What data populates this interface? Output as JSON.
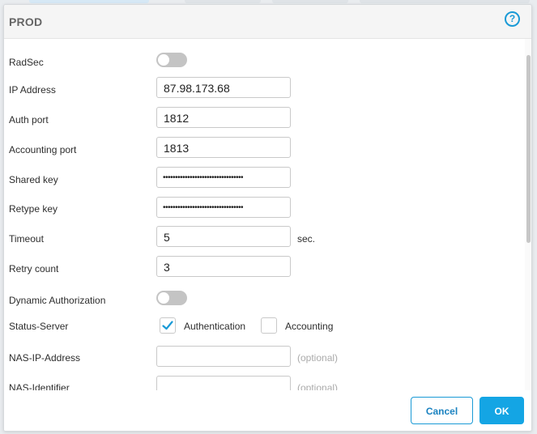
{
  "dialog": {
    "title": "PROD",
    "help_icon": "help-circle-icon"
  },
  "fields": {
    "radsec": {
      "label": "RadSec",
      "on": false
    },
    "ip_address": {
      "label": "IP Address",
      "value": "87.98.173.68"
    },
    "auth_port": {
      "label": "Auth port",
      "value": "1812"
    },
    "accounting_port": {
      "label": "Accounting port",
      "value": "1813"
    },
    "shared_key": {
      "label": "Shared key",
      "value": "•••••••••••••••••••••••••••••••••"
    },
    "retype_key": {
      "label": "Retype key",
      "value": "•••••••••••••••••••••••••••••••••"
    },
    "timeout": {
      "label": "Timeout",
      "value": "5",
      "suffix": "sec."
    },
    "retry_count": {
      "label": "Retry count",
      "value": "3"
    },
    "dynamic_authorization": {
      "label": "Dynamic Authorization",
      "on": false
    },
    "status_server": {
      "label": "Status-Server",
      "authentication": {
        "label": "Authentication",
        "checked": true
      },
      "accounting": {
        "label": "Accounting",
        "checked": false
      }
    },
    "nas_ip_address": {
      "label": "NAS-IP-Address",
      "value": "",
      "hint": "(optional)"
    },
    "nas_identifier": {
      "label": "NAS-Identifier",
      "value": "",
      "hint": "(optional)"
    }
  },
  "footer": {
    "cancel_label": "Cancel",
    "ok_label": "OK"
  },
  "colors": {
    "accent": "#14a5e4",
    "toggle_off": "#c4c4c4"
  }
}
